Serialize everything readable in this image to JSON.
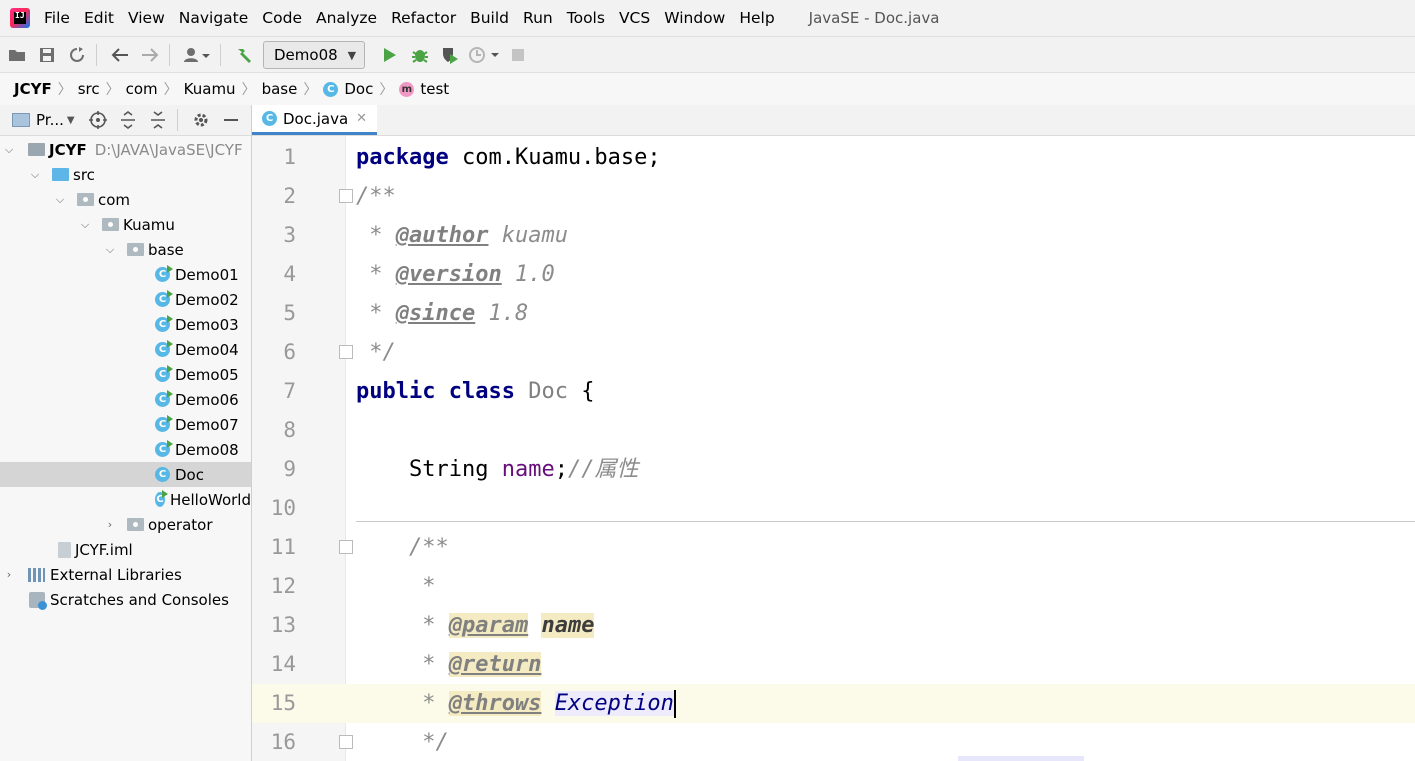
{
  "menubar": {
    "logo_text": "IJ",
    "items": [
      "File",
      "Edit",
      "View",
      "Navigate",
      "Code",
      "Analyze",
      "Refactor",
      "Build",
      "Run",
      "Tools",
      "VCS",
      "Window",
      "Help"
    ],
    "window_title": "JavaSE - Doc.java"
  },
  "toolbar": {
    "run_config": "Demo08"
  },
  "breadcrumb": {
    "items": [
      "JCYF",
      "src",
      "com",
      "Kuamu",
      "base",
      "Doc",
      "test"
    ],
    "class_badge": "C",
    "method_badge": "m"
  },
  "project_panel": {
    "title": "Pr...",
    "root": {
      "name": "JCYF",
      "path": "D:\\JAVA\\JavaSE\\JCYF"
    },
    "src": "src",
    "com": "com",
    "kuamu": "Kuamu",
    "base": "base",
    "class_badge": "C",
    "classes": [
      "Demo01",
      "Demo02",
      "Demo03",
      "Demo04",
      "Demo05",
      "Demo06",
      "Demo07",
      "Demo08",
      "Doc",
      "HelloWorld"
    ],
    "operator": "operator",
    "iml": "JCYF.iml",
    "external": "External Libraries",
    "scratches": "Scratches and Consoles"
  },
  "editor": {
    "tab": {
      "label": "Doc.java",
      "badge": "C",
      "close": "✕"
    },
    "line_numbers": [
      "1",
      "2",
      "3",
      "4",
      "5",
      "6",
      "7",
      "8",
      "9",
      "10",
      "11",
      "12",
      "13",
      "14",
      "15",
      "16"
    ],
    "code": {
      "l1_kw": "package",
      "l1_rest": " com.Kuamu.base;",
      "l2": "/**",
      "l3_star": " * ",
      "l3_tag": "@author",
      "l3_val": " kuamu",
      "l4_star": " * ",
      "l4_tag": "@version",
      "l4_val": " 1.0",
      "l5_star": " * ",
      "l5_tag": "@since",
      "l5_val": " 1.8",
      "l6": " */",
      "l7_kw1": "public",
      "l7_kw2": "class",
      "l7_name": "Doc",
      "l7_brace": " {",
      "l9_indent": "    ",
      "l9_type": "String",
      "l9_field": "name",
      "l9_semi": ";",
      "l9_cmt": "//属性",
      "l11": "    /**",
      "l12": "     *",
      "l13_star": "     * ",
      "l13_tag": "@param",
      "l13_val": "name",
      "l14_star": "     * ",
      "l14_tag": "@return",
      "l15_star": "     * ",
      "l15_tag": "@throws",
      "l15_val": "Exception",
      "l16": "     */"
    }
  }
}
